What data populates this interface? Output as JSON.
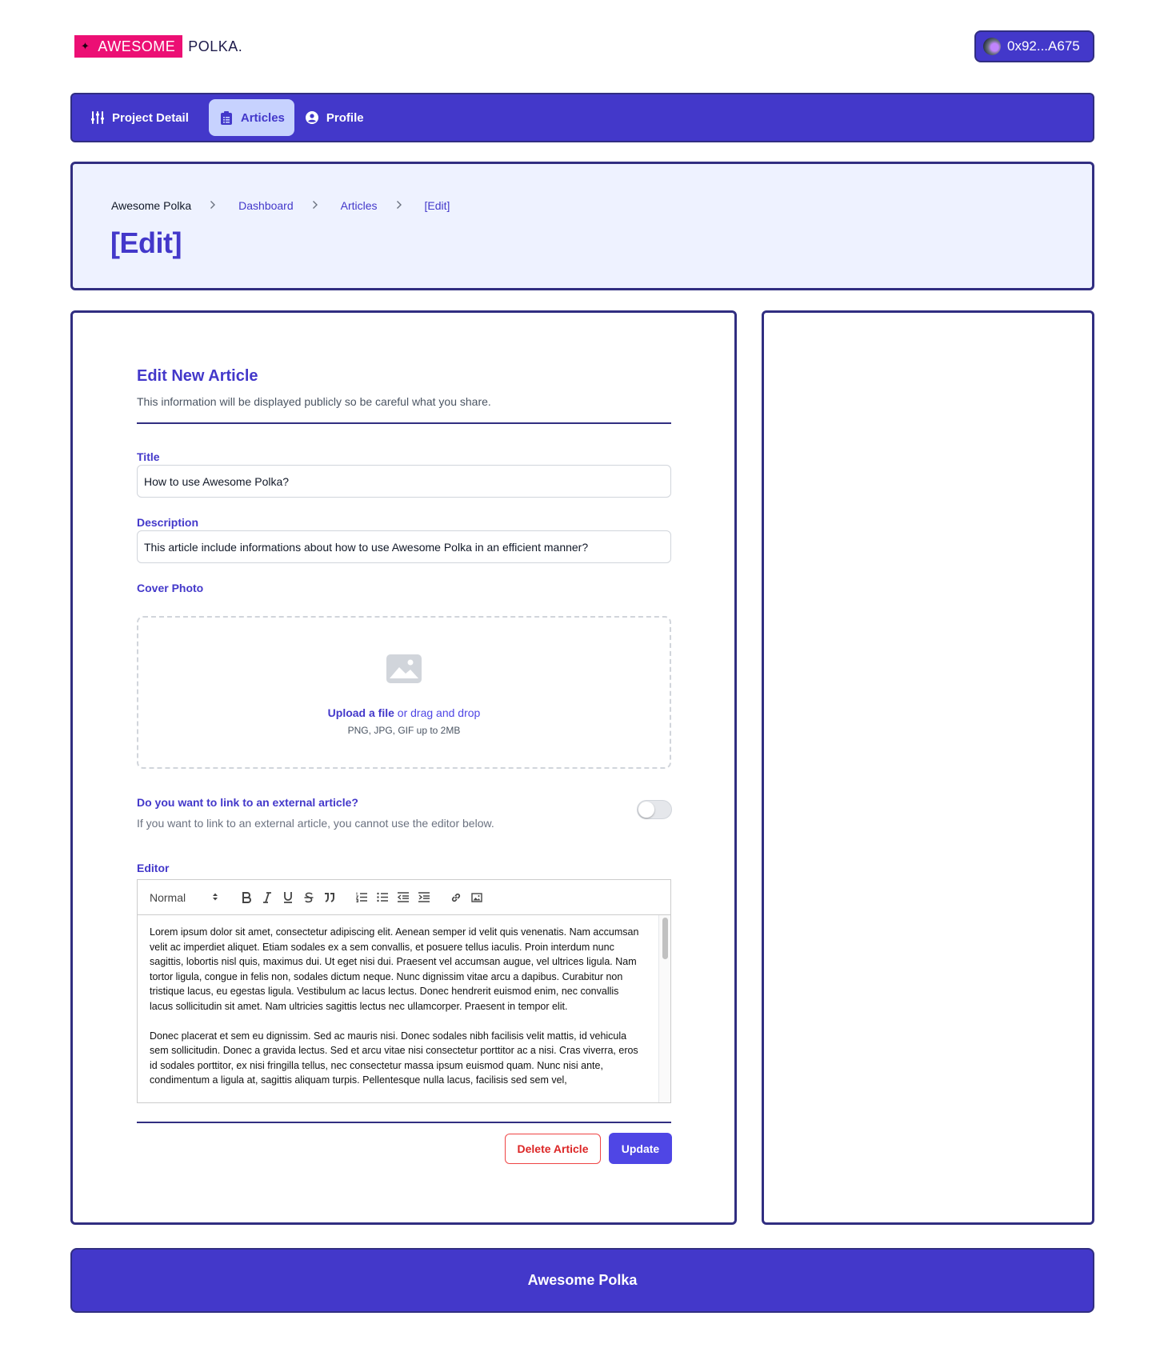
{
  "header": {
    "logo_mark": "✦",
    "logo_highlight": "AWESOME",
    "logo_rest": "POLKA.",
    "wallet_label": "0x92...A675"
  },
  "nav": {
    "items": [
      {
        "label": "Project Detail",
        "icon": "sliders-icon",
        "active": false
      },
      {
        "label": "Articles",
        "icon": "clipboard-list-icon",
        "active": true
      },
      {
        "label": "Profile",
        "icon": "user-circle-icon",
        "active": false
      }
    ]
  },
  "breadcrumb": {
    "items": [
      "Awesome Polka",
      "Dashboard",
      "Articles",
      "[Edit]"
    ],
    "separator": ">"
  },
  "page_title": "[Edit]",
  "form": {
    "title": "Edit New Article",
    "subtitle": "This information will be displayed publicly so be careful what you share.",
    "title_label": "Title",
    "title_value": "How to use Awesome Polka?",
    "description_label": "Description",
    "description_value": "This article include informations about how to use Awesome Polka in an efficient manner?",
    "cover_label": "Cover Photo",
    "upload_link": "Upload a file",
    "upload_rest": " or drag and drop",
    "upload_hint": "PNG, JPG, GIF up to 2MB",
    "external_question": "Do you want to link to an external article?",
    "external_description": "If you want to link to an external article, you cannot use the editor below.",
    "external_toggle_on": false,
    "editor_label": "Editor",
    "editor_format": "Normal",
    "editor_paragraphs": [
      "Lorem ipsum dolor sit amet, consectetur adipiscing elit. Aenean semper id velit quis venenatis. Nam accumsan velit ac imperdiet aliquet. Etiam sodales ex a sem convallis, et posuere tellus iaculis. Proin interdum nunc sagittis, lobortis nisl quis, maximus dui. Ut eget nisi dui. Praesent vel accumsan augue, vel ultrices ligula. Nam tortor ligula, congue in felis non, sodales dictum neque. Nunc dignissim vitae arcu a dapibus. Curabitur non tristique lacus, eu egestas ligula. Vestibulum ac lacus lectus. Donec hendrerit euismod enim, nec convallis lacus sollicitudin sit amet. Nam ultricies sagittis lectus nec ullamcorper. Praesent in tempor elit.",
      "Donec placerat et sem eu dignissim. Sed ac mauris nisi. Donec sodales nibh facilisis velit mattis, id vehicula sem sollicitudin. Donec a gravida lectus. Sed et arcu vitae nisi consectetur porttitor ac a nisi. Cras viverra, eros id sodales porttitor, ex nisi fringilla tellus, nec consectetur massa ipsum euismod quam. Nunc nisi ante, condimentum a ligula at, sagittis aliquam turpis. Pellentesque nulla lacus, facilisis sed sem vel,"
    ],
    "delete_label": "Delete Article",
    "update_label": "Update"
  },
  "footer": {
    "text": "Awesome Polka"
  },
  "colors": {
    "brand": "#4338ca",
    "brand_dark": "#312e81",
    "logo_pink": "#ec0f74",
    "danger": "#dc2626"
  }
}
